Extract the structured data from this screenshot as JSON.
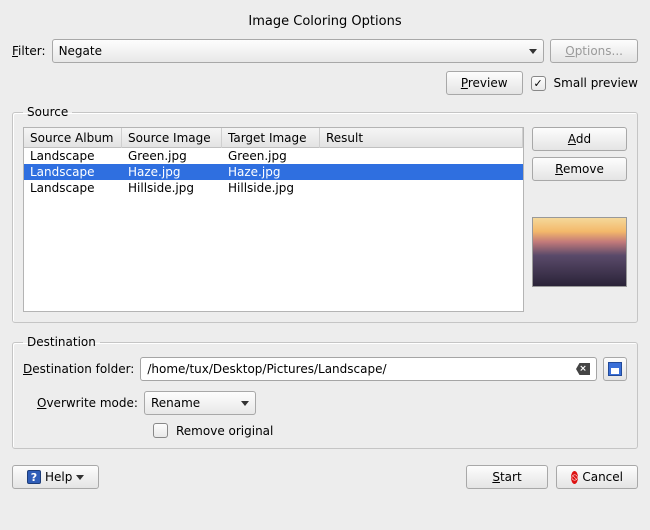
{
  "title": "Image Coloring Options",
  "filter": {
    "label": "Filter:",
    "value": "Negate",
    "options_label": "Options..."
  },
  "preview": {
    "button": "Preview",
    "small_checkbox_label": "Small preview",
    "small_checked": true
  },
  "source": {
    "legend": "Source",
    "columns": [
      "Source Album",
      "Source Image",
      "Target Image",
      "Result"
    ],
    "rows": [
      {
        "album": "Landscape",
        "src": "Green.jpg",
        "target": "Green.jpg",
        "result": "",
        "selected": false
      },
      {
        "album": "Landscape",
        "src": "Haze.jpg",
        "target": "Haze.jpg",
        "result": "",
        "selected": true
      },
      {
        "album": "Landscape",
        "src": "Hillside.jpg",
        "target": "Hillside.jpg",
        "result": "",
        "selected": false
      }
    ],
    "add_label": "Add",
    "remove_label": "Remove"
  },
  "destination": {
    "legend": "Destination",
    "folder_label": "Destination folder:",
    "folder_value": "/home/tux/Desktop/Pictures/Landscape/",
    "overwrite_label": "Overwrite mode:",
    "overwrite_value": "Rename",
    "remove_original_label": "Remove original",
    "remove_original_checked": false
  },
  "footer": {
    "help": "Help",
    "start": "Start",
    "cancel": "Cancel"
  }
}
